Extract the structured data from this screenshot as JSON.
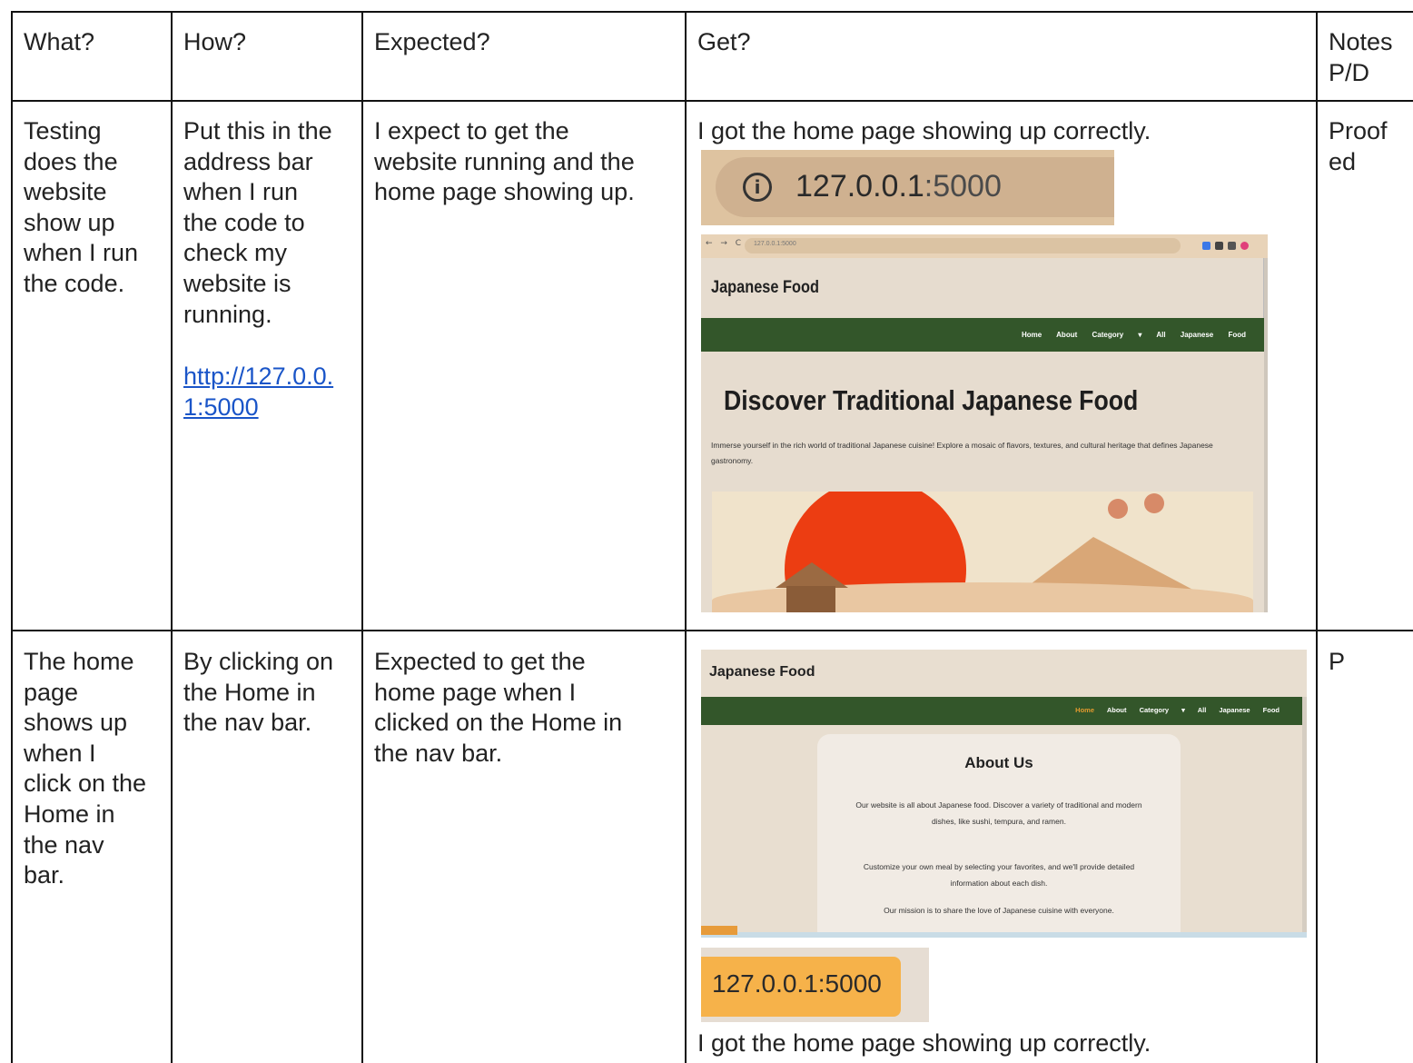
{
  "table": {
    "headers": {
      "what": "What?",
      "how": "How?",
      "expected": "Expected?",
      "get": "Get?",
      "notes": "Notes\nP/D"
    },
    "rows": [
      {
        "what": "Testing\ndoes the\nwebsite\nshow up\nwhen I run\nthe code.",
        "how": "Put this in the\naddress bar\nwhen I run\nthe code to\ncheck my\nwebsite is\nrunning.",
        "how_link": "http://127.0.0.\n1:5000",
        "expected": "I expect to get the\nwebsite running and the\nhome page showing up.",
        "get": "I got the home page showing up correctly.",
        "notes": "Proof\ned"
      },
      {
        "what": "The home\npage\nshows up\nwhen I\nclick on the\nHome in\nthe nav\nbar.",
        "how": "By clicking on\nthe Home in\nthe nav bar.",
        "expected": "Expected to get the\nhome page when I\nclicked on the Home in\nthe nav bar.",
        "get": "I got the home page showing up correctly.",
        "notes": "P"
      }
    ]
  },
  "screenshot1": {
    "address_host": "127.0.0.1",
    "address_port": ":5000",
    "info_icon": "info-icon",
    "small_url": "127.0.0.1:5000",
    "brand": "Japanese Food",
    "menu": "Home About Category ▾ All Japanese Food",
    "hero_title": "Discover Traditional Japanese Food",
    "hero_text": "Immerse yourself in the rich world of traditional Japanese cuisine! Explore a mosaic of flavors, textures, and cultural heritage that defines Japanese gastronomy."
  },
  "screenshot2": {
    "brand": "Japanese Food",
    "menu_home": "Home",
    "menu_rest": "About Category ▾ All Japanese Food",
    "about_title": "About Us",
    "para1": "Our website is all about Japanese food. Discover a variety of traditional and modern dishes, like sushi, tempura, and ramen.",
    "para2": "Customize your own meal by selecting your favorites, and we'll provide detailed information about each dish.",
    "para3": "Our mission is to share the love of Japanese cuisine with everyone.",
    "address": "127.0.0.1:5000"
  },
  "colors": {
    "nav_green": "#33562a",
    "link_blue": "#1a55c8",
    "sun_red": "#ec3d12",
    "address_orange": "#f6b24a"
  }
}
